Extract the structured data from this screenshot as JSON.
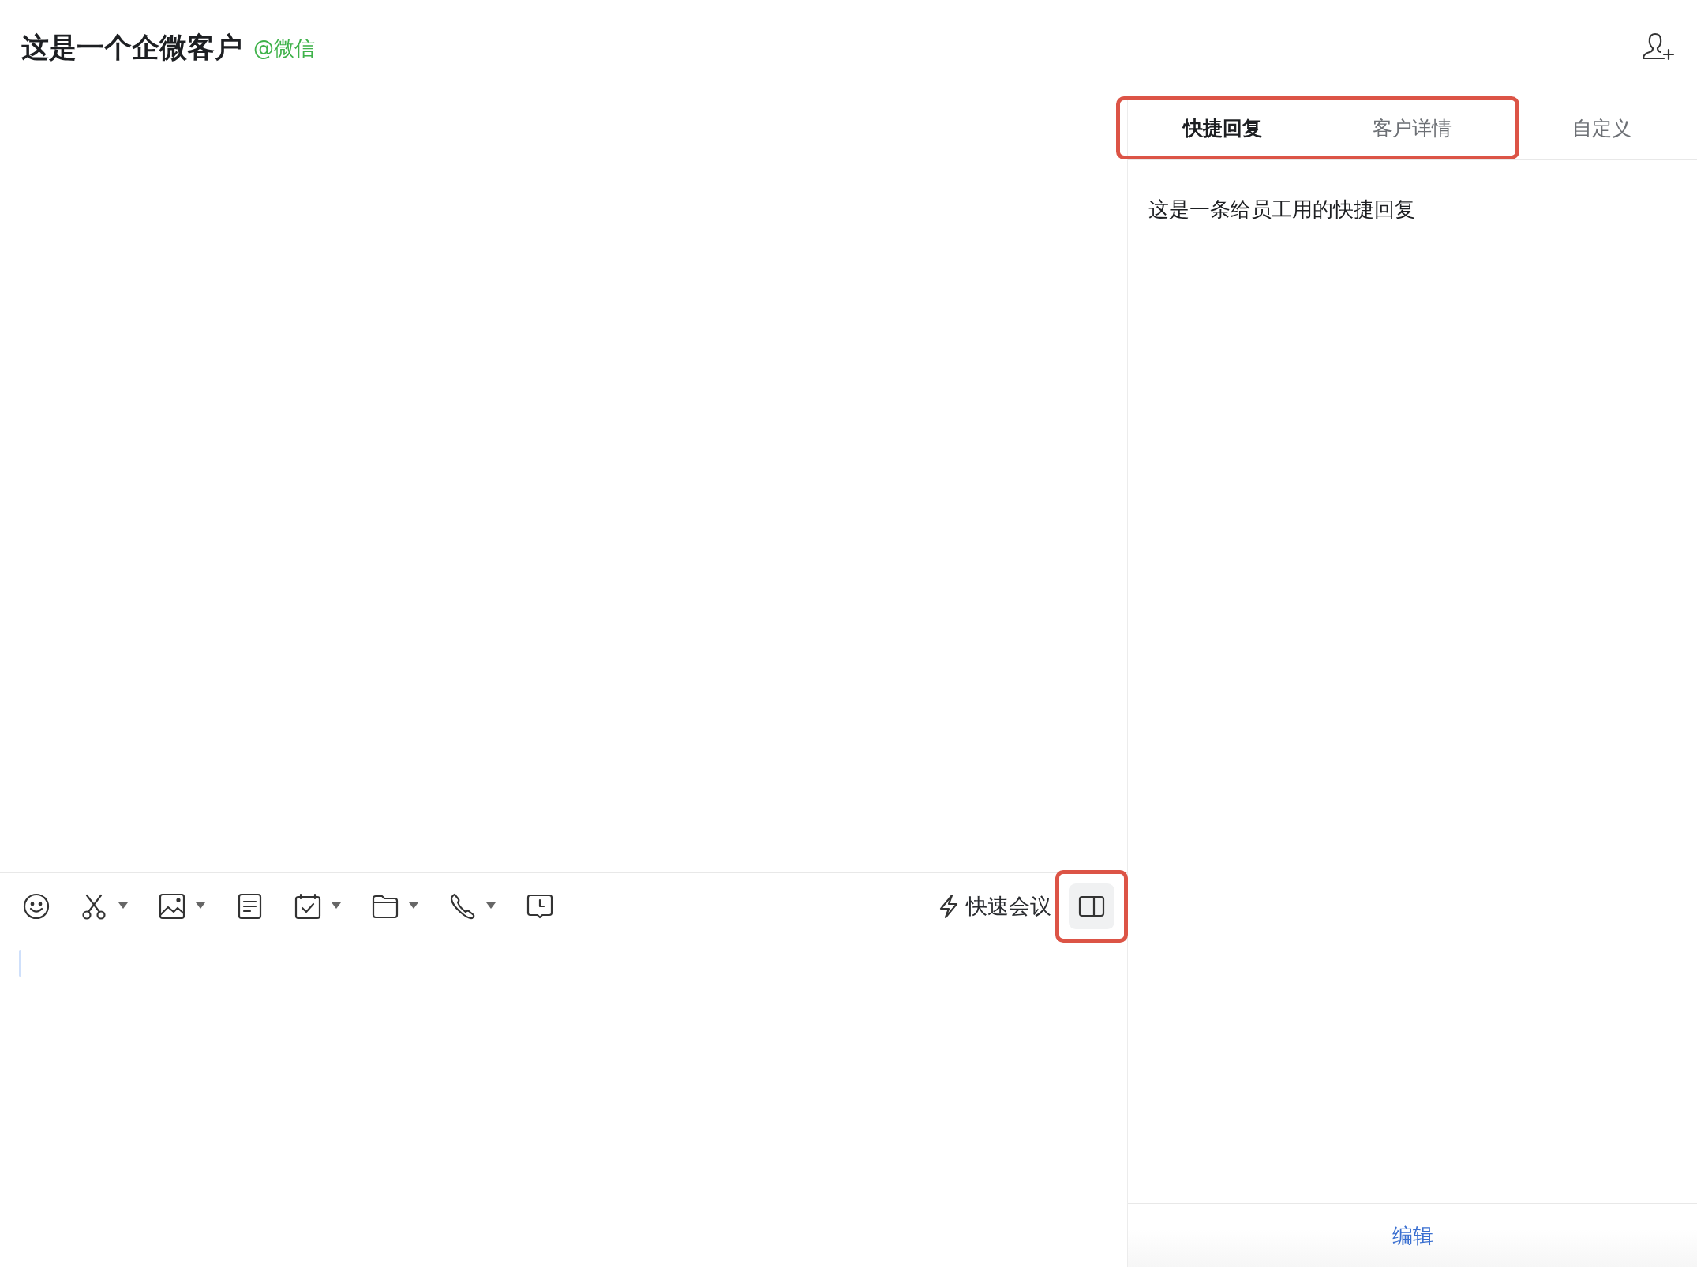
{
  "header": {
    "title": "这是一个企微客户",
    "source": "@微信"
  },
  "toolbar": {
    "tools": [
      {
        "kind": "emoji",
        "dropdown": false
      },
      {
        "kind": "scissors",
        "dropdown": true
      },
      {
        "kind": "image",
        "dropdown": true
      },
      {
        "kind": "document",
        "dropdown": false
      },
      {
        "kind": "calendar",
        "dropdown": true
      },
      {
        "kind": "folder",
        "dropdown": true
      },
      {
        "kind": "phone",
        "dropdown": true
      },
      {
        "kind": "clock-message",
        "dropdown": false
      }
    ],
    "meeting_button": {
      "label": "快速会议"
    },
    "panel_toggle": {
      "selected": true,
      "highlighted": true
    }
  },
  "right_panel": {
    "tabs": [
      {
        "label": "快捷回复",
        "selected": true,
        "highlighted": true
      },
      {
        "label": "客户详情",
        "selected": false,
        "highlighted": true
      },
      {
        "label": "自定义",
        "selected": false,
        "highlighted": false
      }
    ],
    "quick_replies": [
      "这是一条给员工用的快捷回复"
    ],
    "edit_button": {
      "label": "编辑"
    }
  }
}
